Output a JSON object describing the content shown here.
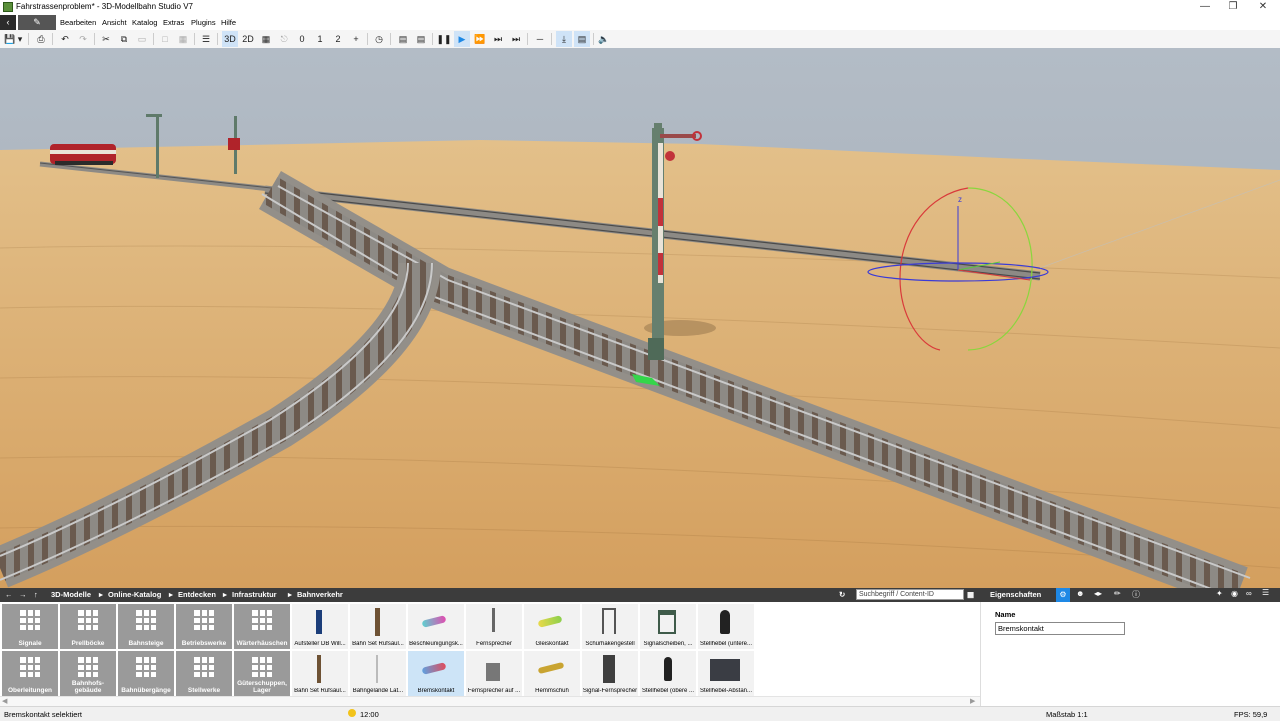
{
  "window": {
    "title": "Fahrstrassenproblem* - 3D-Modellbahn Studio V7",
    "controls": [
      "—",
      "❐",
      "✕"
    ]
  },
  "menu": {
    "back_icon": "‹",
    "edit_icon": "✎",
    "items": [
      "Bearbeiten",
      "Ansicht",
      "Katalog",
      "Extras",
      "Plugins",
      "Hilfe"
    ]
  },
  "toolbar": {
    "view_3d": "3D",
    "view_2d": "2D",
    "speed_0": "0",
    "speed_1": "1",
    "speed_2": "2"
  },
  "breadcrumb": {
    "items": [
      "3D-Modelle",
      "Online-Katalog",
      "Entdecken",
      "Infrastruktur",
      "Bahnverkehr"
    ],
    "separator": "▸"
  },
  "search": {
    "placeholder": "Suchbegriff / Content-ID"
  },
  "properties_panel": {
    "title": "Eigenschaften",
    "name_label": "Name",
    "name_value": "Bremskontakt"
  },
  "catalog": {
    "categories_row1": [
      "Signale",
      "Prellböcke",
      "Bahnsteige",
      "Betriebswerke",
      "Wärterhäuschen"
    ],
    "categories_row2": [
      "Oberleitungen",
      "Bahnhofs-gebäude",
      "Bahnübergänge",
      "Stellwerke",
      "Güterschuppen, Lager"
    ],
    "items_row1": [
      "Aufsteller DB Will...",
      "Bahn Set Rufsäul...",
      "Beschleunigungsk...",
      "Fernsprecher",
      "Gleiskontakt",
      "Schürhakengestell",
      "Signalscheiben, ...",
      "Stellhebel (untere..."
    ],
    "items_row2": [
      "Bahn Set Rufsäul...",
      "Bahngelände Lat...",
      "Bremskontakt",
      "Fernsprecher auf ...",
      "Hemmschuh",
      "Signal-Fernsprecher",
      "Stellhebel (obere ...",
      "Stellhebel-Abstan..."
    ],
    "selected_item": "Bremskontakt"
  },
  "gizmo": {
    "axis_label": "z"
  },
  "status": {
    "message": "Bremskontakt selektiert",
    "time": "12:00",
    "scale": "Maßstab 1:1",
    "fps": "FPS: 59,9"
  },
  "colors": {
    "sky": "#a9b3bd",
    "ground": "#d8a766",
    "panel_dark": "#3c3c3c",
    "category_tile": "#9a9a9a",
    "selection": "#cde4f7",
    "accent_blue": "#1e88e5"
  }
}
